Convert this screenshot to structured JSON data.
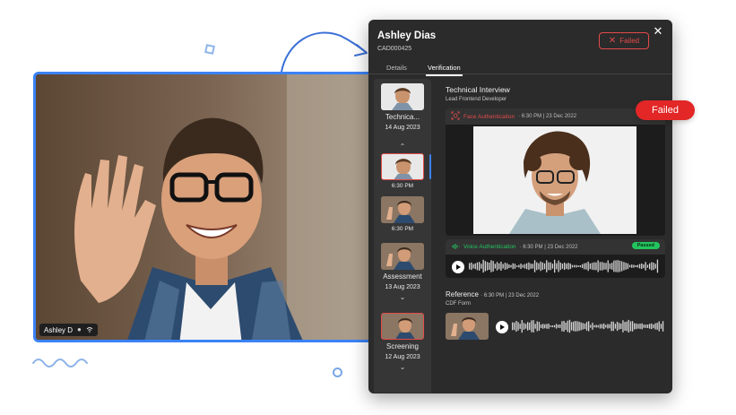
{
  "video": {
    "participant_name": "Ashley D"
  },
  "candidate": {
    "name": "Ashley Dias",
    "id": "CAD000425"
  },
  "status_button": {
    "label": "Failed"
  },
  "tabs": [
    {
      "label": "Details"
    },
    {
      "label": "Verification"
    }
  ],
  "rounds": [
    {
      "label": "Technica...",
      "date": "14 Aug 2023"
    },
    {
      "time_1": "6:30 PM",
      "time_2": "6:30 PM"
    },
    {
      "label": "Assessment",
      "date": "13 Aug 2023"
    },
    {
      "label": "Screening",
      "date": "12 Aug 2023"
    }
  ],
  "main": {
    "title": "Technical Interview",
    "subtitle": "Lead Frontend Developer",
    "face_auth": {
      "label": "Face Authentication",
      "meta": "· 6:30 PM | 23 Dec 2022"
    },
    "voice_auth": {
      "label": "Voice Authentication",
      "meta": "· 6:30 PM | 23 Dec 2022",
      "status": "Passed"
    },
    "reference": {
      "title": "Reference",
      "meta": "· 6:30 PM | 23 Dec 2022",
      "subtitle": "CDF Form"
    }
  },
  "badge": {
    "label": "Failed"
  },
  "colors": {
    "accent": "#3b82f6",
    "failed": "#e32626",
    "face_label": "#e24a4a",
    "voice_label": "#22c55e",
    "panel_bg": "#2b2b2b"
  },
  "icons": [
    "close-icon",
    "x-icon",
    "mic-icon",
    "wifi-icon",
    "face-scan-icon",
    "voice-icon",
    "play-icon",
    "chevron-up-icon",
    "chevron-down-icon"
  ]
}
